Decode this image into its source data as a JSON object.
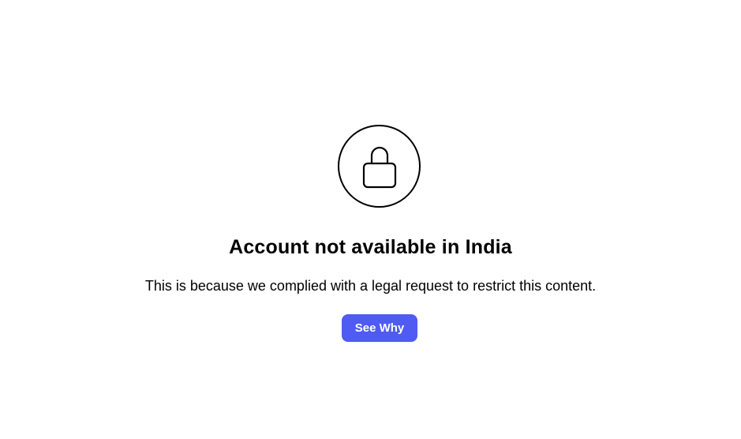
{
  "notice": {
    "icon": "lock-icon",
    "title": "Account not available in India",
    "message": "This is because we complied with a legal request to restrict this content.",
    "button_label": "See Why"
  },
  "colors": {
    "background": "#ffffff",
    "text": "#000000",
    "button_background": "#4f5bf3",
    "button_text": "#ffffff"
  }
}
